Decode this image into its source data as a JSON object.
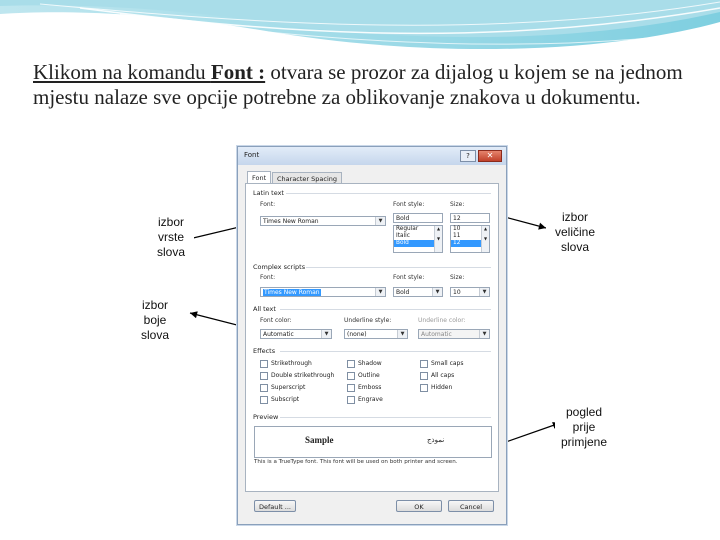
{
  "intro": {
    "cmd_part1": "Klikom na komandu ",
    "cmd_font": "Font :",
    "rest": " otvara se prozor za dijalog u kojem se na jednom mjestu nalaze sve opcije potrebne za oblikovanje znakova u dokumentu."
  },
  "callouts": {
    "font_type": [
      "izbor",
      "vrste",
      "slova"
    ],
    "font_size": [
      "izbor",
      "veličine",
      "slova"
    ],
    "font_color": [
      "izbor",
      "boje",
      "slova"
    ],
    "preview": [
      "pogled",
      "prije",
      "primjene"
    ]
  },
  "dialog": {
    "title": "Font",
    "help": "?",
    "close": "✕",
    "tabs": [
      "Font",
      "Character Spacing"
    ],
    "latin_text": {
      "section": "Latin text",
      "font_label": "Font:",
      "font_value": "Times New Roman",
      "style_label": "Font style:",
      "style_value": "Bold",
      "style_options": [
        "Regular",
        "Italic",
        "Bold"
      ],
      "size_label": "Size:",
      "size_value": "12",
      "size_options": [
        "10",
        "11",
        "12"
      ]
    },
    "complex_scripts": {
      "section": "Complex scripts",
      "font_label": "Font:",
      "font_value": "Times New Roman",
      "style_label": "Font style:",
      "style_value": "Bold",
      "size_label": "Size:",
      "size_value": "10"
    },
    "all_text": {
      "section": "All text",
      "font_color_label": "Font color:",
      "font_color_value": "Automatic",
      "underline_style_label": "Underline style:",
      "underline_style_value": "(none)",
      "underline_color_label": "Underline color:",
      "underline_color_value": "Automatic"
    },
    "effects": {
      "section": "Effects",
      "items": [
        "Strikethrough",
        "Double strikethrough",
        "Superscript",
        "Subscript",
        "Shadow",
        "Outline",
        "Emboss",
        "Engrave",
        "Small caps",
        "All caps",
        "Hidden"
      ]
    },
    "preview": {
      "section": "Preview",
      "sample": "Sample",
      "arabic": "نموذج",
      "note": "This is a TrueType font. This font will be used on both printer and screen."
    },
    "buttons": {
      "default": "Default ...",
      "ok": "OK",
      "cancel": "Cancel"
    }
  }
}
